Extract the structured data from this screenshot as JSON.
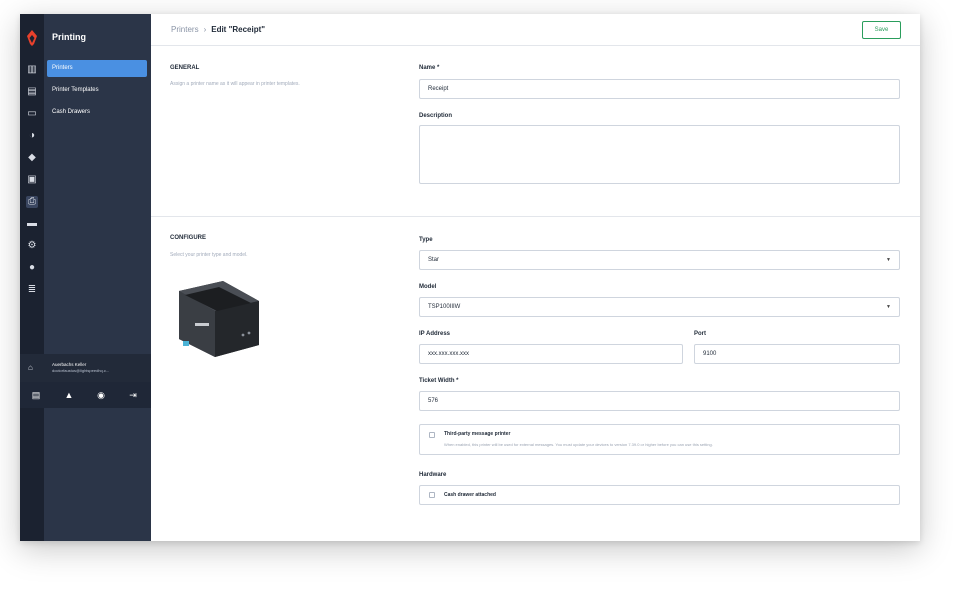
{
  "sidebar": {
    "title": "Printing",
    "items": [
      {
        "label": "Printers"
      },
      {
        "label": "Printer Templates"
      },
      {
        "label": "Cash Drawers"
      }
    ],
    "user": {
      "name": "Auerbachs Keller",
      "email": "doctorfaustus@lightspeedhq.c..."
    }
  },
  "rail_icons": [
    "chart-icon",
    "receipt-icon",
    "id-card-icon",
    "discount-icon",
    "layers-icon",
    "register-icon",
    "printer-icon",
    "card-icon",
    "gear-icon",
    "help-icon",
    "reports-icon"
  ],
  "breadcrumb": {
    "parent": "Printers",
    "separator": "›",
    "current": "Edit \"Receipt\""
  },
  "toolbar": {
    "save_label": "Save"
  },
  "general": {
    "title": "GENERAL",
    "description": "Assign a printer name as it will appear in printer templates.",
    "name_label": "Name *",
    "name_value": "Receipt",
    "description_label": "Description",
    "description_value": ""
  },
  "configure": {
    "title": "CONFIGURE",
    "description": "Select your printer type and model.",
    "type_label": "Type",
    "type_value": "Star",
    "model_label": "Model",
    "model_value": "TSP100IIIW",
    "ip_label": "IP Address",
    "ip_value": "xxx.xxx.xxx.xxx",
    "port_label": "Port",
    "port_value": "9100",
    "ticket_width_label": "Ticket Width *",
    "ticket_width_value": "576",
    "third_party_title": "Third-party message printer",
    "third_party_desc": "When enabled, this printer will be used for external messages. You must update your devices to version 7.39.0 or higher before you can use this setting.",
    "hardware_label": "Hardware",
    "cash_drawer_label": "Cash drawer attached"
  },
  "colors": {
    "accent": "#4a90e2",
    "save": "#2a9d5c",
    "sidebar": "#2b3548",
    "rail": "#1b2230",
    "logo": "#e8412c"
  }
}
